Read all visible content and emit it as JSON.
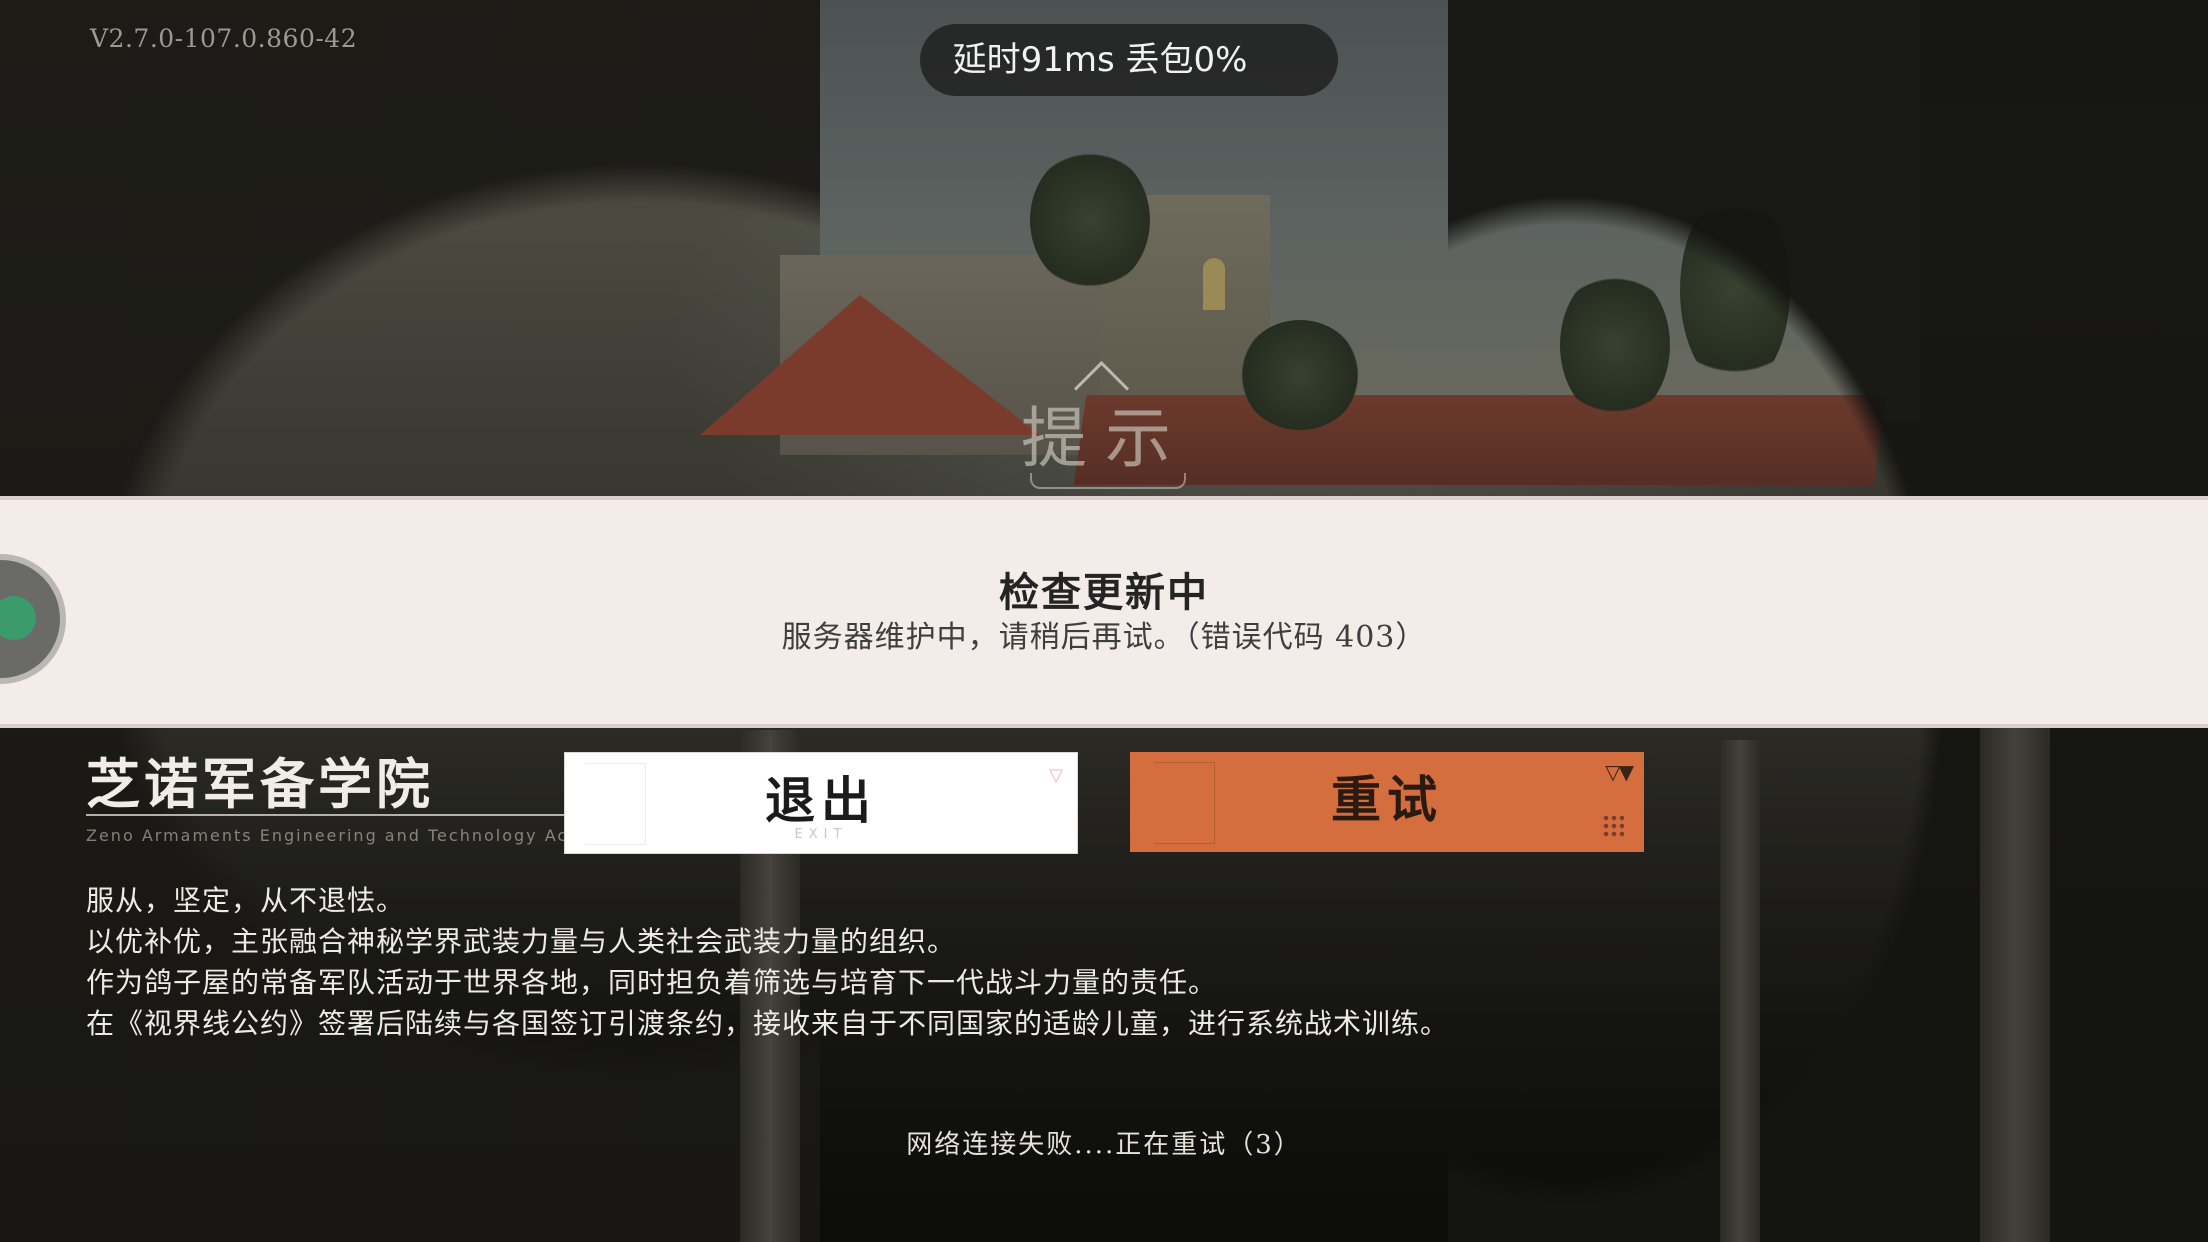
{
  "hud": {
    "version": "V2.7.0-107.0.860-42",
    "network_status": "延时91ms 丢包0%"
  },
  "dialog": {
    "title": "提示",
    "heading": "检查更新中",
    "message": "服务器维护中，请稍后再试。（错误代码 403）"
  },
  "academy": {
    "name": "芝诺军备学院",
    "english_name": "Zeno Armaments Engineering and Technology Academy",
    "lines": [
      "服从，坚定，从不退怯。",
      "以优补优，主张融合神秘学界武装力量与人类社会武装力量的组织。",
      "作为鸽子屋的常备军队活动于世界各地，同时担负着筛选与培育下一代战斗力量的责任。",
      "在《视界线公约》签署后陆续与各国签订引渡条约，接收来自于不同国家的适龄儿童，进行系统战术训练。"
    ]
  },
  "buttons": {
    "exit_label": "退出",
    "exit_sub": "EXIT",
    "retry_label": "重试"
  },
  "status": {
    "text": "网络连接失败....正在重试（3）"
  },
  "icons": {
    "floating_ball": "floating-assistant-icon",
    "exit_corner": "triangle-marker-icon",
    "retry_corner": "double-triangle-marker-icon"
  },
  "colors": {
    "dialog_band": "#f3ece8",
    "retry_accent": "#d46e3e",
    "exit_background": "#ffffff"
  }
}
